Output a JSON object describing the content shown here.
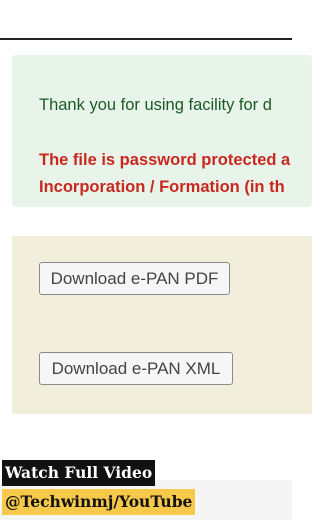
{
  "notice": {
    "thank_you": "Thank you for using facility for d",
    "warning_line1": "The file is password protected a",
    "warning_line2": "Incorporation / Formation (in th"
  },
  "downloads": {
    "pdf_label": "Download e-PAN PDF",
    "xml_label": "Download e-PAN XML"
  },
  "overlay": {
    "line1": "Watch Full Video",
    "line2": "@Techwinmj/YouTube"
  },
  "icons": {
    "extension": "puzzle-icon"
  },
  "colors": {
    "notice_background": "#e8f4ea",
    "success_text": "#1c5a25",
    "warning_text": "#c8281e",
    "download_background": "#f1eedb",
    "promo_highlight": "#f7c94a"
  }
}
